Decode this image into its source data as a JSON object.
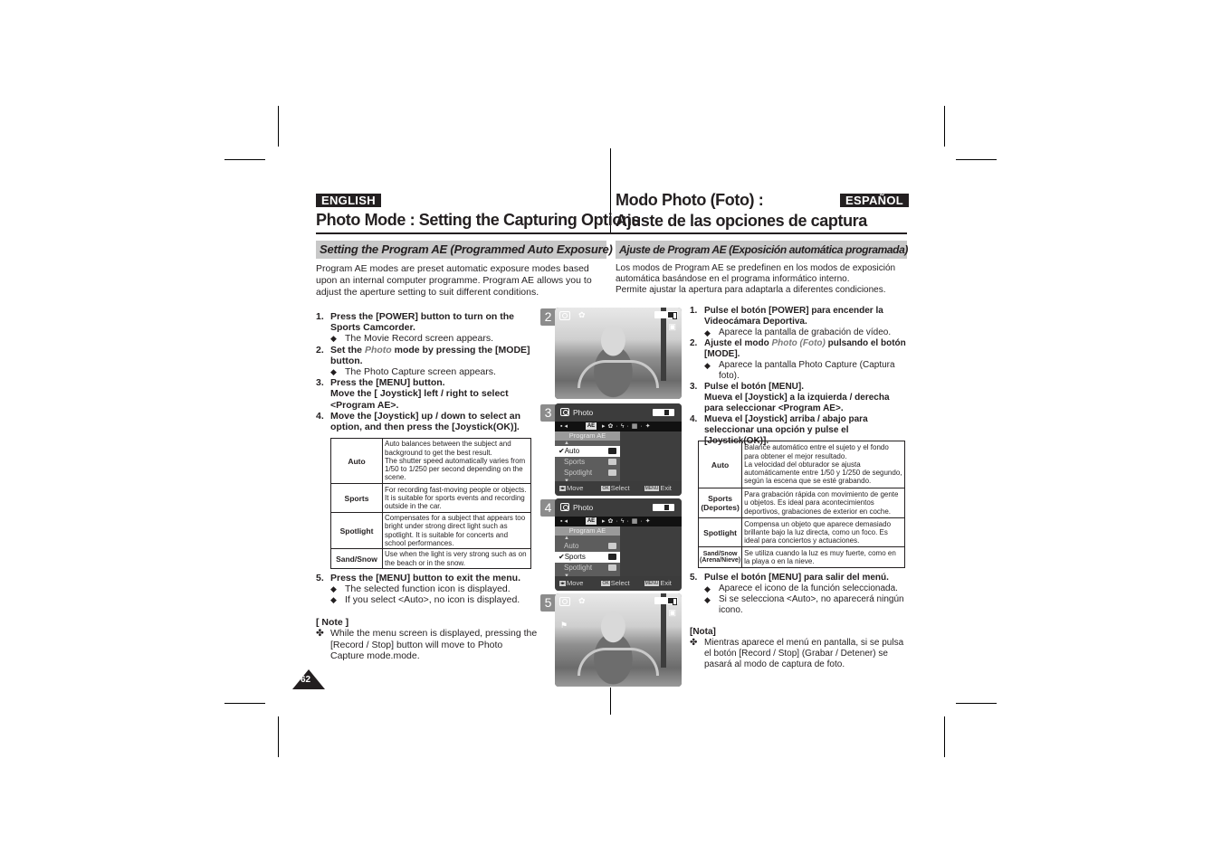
{
  "english": {
    "language_badge": "ENGLISH",
    "title": "Photo Mode : Setting the Capturing Options",
    "section_heading": "Setting the Program AE (Programmed Auto Exposure)",
    "intro": "Program AE modes are preset automatic exposure modes based upon an internal computer programme. Program AE allows you to adjust the aperture setting to suit different conditions.",
    "steps": [
      {
        "num": "1.",
        "text": "Press the [POWER] button to turn on the Sports Camcorder.",
        "bullets": [
          "The Movie Record screen appears."
        ]
      },
      {
        "num": "2.",
        "text_before": "Set the ",
        "text_italic": "Photo",
        "text_after": " mode by pressing the [MODE] button.",
        "bullets": [
          "The Photo Capture screen appears."
        ]
      },
      {
        "num": "3.",
        "text": "Press the [MENU] button.",
        "text2": "Move the [ Joystick] left / right to select <Program AE>."
      },
      {
        "num": "4.",
        "text": "Move the [Joystick] up / down to select an option, and then press the [Joystick(OK)]."
      },
      {
        "num": "5.",
        "text": "Press the [MENU] button to exit the menu.",
        "bullets": [
          "The selected function icon is displayed.",
          "If you select <Auto>, no icon is displayed."
        ]
      }
    ],
    "modes_table": [
      {
        "mode": "Auto",
        "description": "Auto balances between the subject and background to get the best result.\nThe shutter speed automatically varies from 1/50 to 1/250 per second depending on the scene."
      },
      {
        "mode": "Sports",
        "description": "For recording fast-moving people or objects. It is suitable for sports events and recording outside in the car."
      },
      {
        "mode": "Spotlight",
        "description": "Compensates for a subject that appears too bright under strong direct light such as spotlight. It is suitable for concerts and school performances."
      },
      {
        "mode": "Sand/Snow",
        "description": "Use when the light is very strong such as on the beach or in the snow."
      }
    ],
    "note_title": "[ Note ]",
    "note_text": "While the menu screen is displayed, pressing the [Record / Stop] button will move to Photo Capture mode.mode."
  },
  "espanol": {
    "language_badge": "ESPAÑOL",
    "title_line1": "Modo Photo (Foto) :",
    "title_line2": "Ajuste de las opciones de captura",
    "section_heading": "Ajuste de Program AE (Exposición automática programada)",
    "intro": "Los modos de Program AE se predefinen en los modos de exposición automática basándose en el programa informático interno.\nPermite ajustar la apertura para adaptarla a diferentes condiciones.",
    "steps": [
      {
        "num": "1.",
        "text": "Pulse el botón [POWER] para encender la Videocámara Deportiva.",
        "bullets": [
          "Aparece la pantalla de grabación de vídeo."
        ]
      },
      {
        "num": "2.",
        "text_before": "Ajuste el modo ",
        "text_italic": "Photo (Foto)",
        "text_after": " pulsando el botón [MODE].",
        "bullets": [
          "Aparece la pantalla Photo Capture (Captura foto)."
        ]
      },
      {
        "num": "3.",
        "text": "Pulse el botón [MENU].",
        "text2": "Mueva el [Joystick] a la izquierda / derecha para seleccionar <Program AE>."
      },
      {
        "num": "4.",
        "text": "Mueva el [Joystick] arriba / abajo para seleccionar una opción y pulse el [Joystick(OK)]."
      },
      {
        "num": "5.",
        "text": "Pulse el botón [MENU] para salir del menú.",
        "bullets": [
          "Aparece el icono de la función seleccionada.",
          "Si se selecciona <Auto>, no aparecerá ningún icono."
        ]
      }
    ],
    "modes_table": [
      {
        "mode": "Auto",
        "mode_sub": "",
        "description": "Balance automático entre el sujeto y el fondo para obtener el mejor resultado.\nLa velocidad del obturador se ajusta automáticamente entre 1/50 y 1/250 de segundo, según la escena que se esté grabando."
      },
      {
        "mode": "Sports",
        "mode_sub": "(Deportes)",
        "description": "Para grabación rápida con movimiento de gente u objetos. Es ideal para acontecimientos deportivos, grabaciones de exterior en coche."
      },
      {
        "mode": "Spotlight",
        "mode_sub": "",
        "description": "Compensa un objeto que aparece demasiado brillante bajo la luz directa, como un foco. Es ideal para conciertos y actuaciones."
      },
      {
        "mode": "Sand/Snow",
        "mode_sub": "(Arena/Nieve)",
        "description": "Se utiliza cuando la luz es muy fuerte, como en la playa o en la nieve."
      }
    ],
    "note_title": "[Nota]",
    "note_text": "Mientras aparece el menú en pantalla, si se pulsa el botón [Record / Stop] (Grabar / Detener) se pasará al modo de captura de foto."
  },
  "screens": [
    {
      "step": "2",
      "type": "photo",
      "icons": [
        "camera-icon",
        "auto-mode-icon",
        "memory-card-icon",
        "battery-icon"
      ]
    },
    {
      "step": "3",
      "type": "menu",
      "header": "Photo",
      "submenu_title": "Program AE",
      "items": [
        {
          "label": "Auto",
          "selected": true
        },
        {
          "label": "Sports",
          "selected": false
        },
        {
          "label": "Spotlight",
          "selected": false
        }
      ],
      "footer": {
        "move": "Move",
        "select": "Select",
        "exit": "Exit",
        "ok_key": "OK",
        "menu_key": "MENU"
      }
    },
    {
      "step": "4",
      "type": "menu",
      "header": "Photo",
      "submenu_title": "Program AE",
      "items": [
        {
          "label": "Auto",
          "selected": false
        },
        {
          "label": "Sports",
          "selected": true
        },
        {
          "label": "Spotlight",
          "selected": false
        }
      ],
      "footer": {
        "move": "Move",
        "select": "Select",
        "exit": "Exit",
        "ok_key": "OK",
        "menu_key": "MENU"
      }
    },
    {
      "step": "5",
      "type": "photo",
      "icons": [
        "camera-icon",
        "auto-mode-icon",
        "sports-mode-icon",
        "memory-card-icon",
        "battery-icon"
      ]
    }
  ],
  "page_number": "62",
  "bullet_glyph": "◆",
  "note_glyph": "✤",
  "check_glyph": "✔",
  "colors": {
    "section_bar": "#c8c8c8",
    "badge_bg": "#231f20",
    "italic_mode": "#7a7a7a"
  }
}
